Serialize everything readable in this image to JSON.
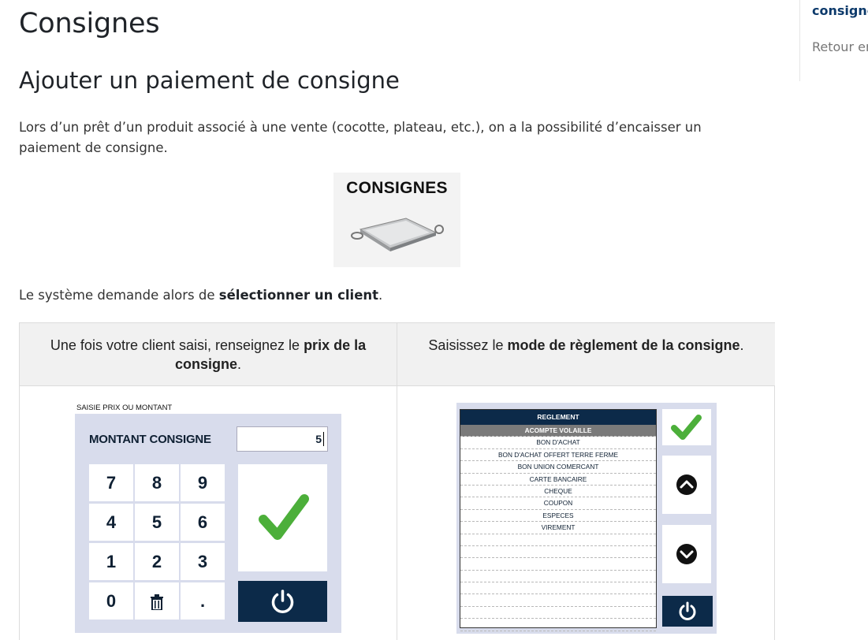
{
  "page": {
    "title": "Consignes",
    "section_title": "Ajouter un paiement de consigne",
    "intro": "Lors d’un prêt d’un produit associé à une vente (cocotte, plateau, etc.), on a la possibilité d’encaisser un paiement de consigne.",
    "hero_label": "CONSIGNES",
    "system_line_prefix": "Le système demande alors de ",
    "system_line_bold": "sélectionner un client",
    "system_line_suffix": "."
  },
  "table": {
    "col1": {
      "prefix": "Une fois votre client saisi, renseignez le ",
      "bold": "prix de la consigne",
      "suffix": "."
    },
    "col2": {
      "prefix": "Saisissez le ",
      "bold": "mode de règlement de la consigne",
      "suffix": "."
    }
  },
  "keypad": {
    "window_title": "SAISIE PRIX OU MONTANT",
    "label": "MONTANT CONSIGNE",
    "value": "5",
    "keys": [
      "7",
      "8",
      "9",
      "4",
      "5",
      "6",
      "1",
      "2",
      "3",
      "0",
      "trash-icon",
      "."
    ]
  },
  "reglement": {
    "header": "REGLEMENT",
    "selected": "ACOMPTE VOLAILLE",
    "items": [
      "ACOMPTE VOLAILLE",
      "BON D'ACHAT",
      "BON D'ACHAT OFFERT TERRE FERME",
      "BON UNION COMERCANT",
      "CARTE BANCAIRE",
      "CHEQUE",
      "COUPON",
      "ESPECES",
      "VIREMENT"
    ],
    "empty_rows": 8
  },
  "toc": {
    "active": "consignes",
    "item": "Retour en haut"
  },
  "colors": {
    "navy": "#0c2a49",
    "panel": "#d8dcec",
    "check_green": "#4caf3a",
    "toc_active": "#0d3a6b"
  }
}
